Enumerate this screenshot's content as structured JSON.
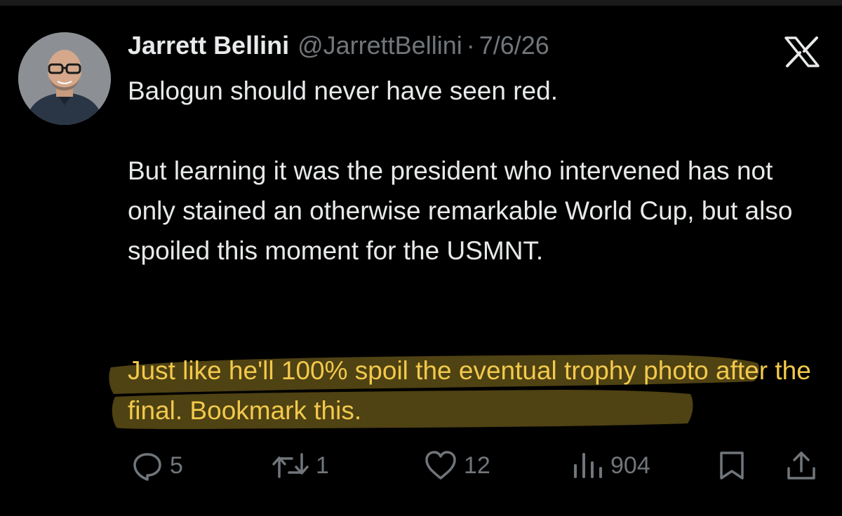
{
  "tweet": {
    "author_name": "Jarrett Bellini",
    "handle": "@JarrettBellini",
    "separator": "·",
    "date": "7/6/26",
    "paragraph_1": "Balogun should never have seen red.",
    "paragraph_2": "But learning it was the president who intervened has not only stained an otherwise remarkable World Cup, but also spoiled this moment for the USMNT.",
    "paragraph_3": "Just like he'll 100% spoil the eventual trophy photo after the final. Bookmark this."
  },
  "actions": {
    "reply_count": "5",
    "repost_count": "1",
    "like_count": "12",
    "views_count": "904"
  },
  "icons": {
    "platform": "x-logo-icon",
    "reply": "reply-icon",
    "repost": "repost-icon",
    "like": "heart-icon",
    "views": "views-icon",
    "bookmark": "bookmark-icon",
    "share": "share-icon"
  },
  "colors": {
    "background": "#000000",
    "text": "#e7e9ea",
    "secondary": "#71767b",
    "highlight_text": "#f2c94c",
    "highlight_marker": "#5a4a14"
  }
}
